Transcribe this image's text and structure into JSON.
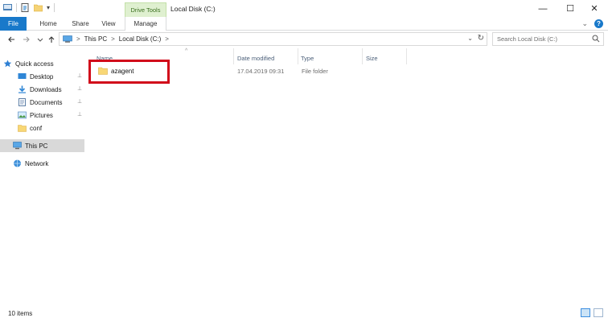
{
  "window": {
    "title": "Local Disk (C:)",
    "controls": {
      "minimize": "—",
      "maximize": "☐",
      "close": "✕"
    }
  },
  "ribbon": {
    "context_group": "Drive Tools",
    "tabs": [
      "File",
      "Home",
      "Share",
      "View",
      "Manage"
    ],
    "active_tab": "Manage",
    "accent_color": "#1979ca",
    "help_label": "?",
    "expand_label": "⌄"
  },
  "navigation": {
    "back_icon": "back-arrow-icon",
    "forward_icon": "forward-arrow-icon",
    "recent_icon": "chevron-down-icon",
    "up_icon": "up-arrow-icon",
    "breadcrumb": [
      "This PC",
      "Local Disk (C:)"
    ],
    "crumb_separator": ">",
    "search_placeholder": "Search Local Disk (C:)"
  },
  "sidebar": {
    "items": [
      {
        "label": "Quick access",
        "icon": "star-icon",
        "pinned": false
      },
      {
        "label": "Desktop",
        "icon": "desktop-icon",
        "pinned": true
      },
      {
        "label": "Downloads",
        "icon": "download-icon",
        "pinned": true
      },
      {
        "label": "Documents",
        "icon": "documents-icon",
        "pinned": true
      },
      {
        "label": "Pictures",
        "icon": "pictures-icon",
        "pinned": true
      },
      {
        "label": "conf",
        "icon": "folder-icon",
        "pinned": false
      },
      {
        "label": "This PC",
        "icon": "computer-icon",
        "pinned": false,
        "selected": true
      },
      {
        "label": "Network",
        "icon": "network-icon",
        "pinned": false
      }
    ],
    "pin_glyph": "📌"
  },
  "file_list": {
    "columns": [
      "Name",
      "Date modified",
      "Type",
      "Size"
    ],
    "sort_glyph": "^",
    "rows": [
      {
        "name": "azagent",
        "date_modified": "17.04.2019 09:31",
        "type": "File folder",
        "size": ""
      }
    ],
    "highlight_color": "#d10a1a"
  },
  "status": {
    "item_count": "10 items",
    "view_modes": [
      "details-view-icon",
      "large-icons-view-icon"
    ]
  }
}
